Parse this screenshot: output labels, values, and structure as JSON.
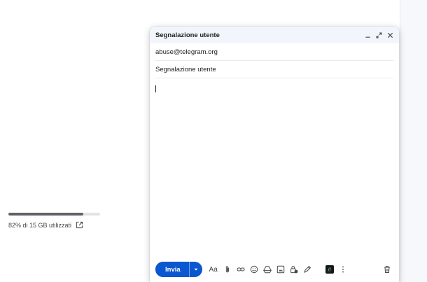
{
  "sidebar": {
    "storage": {
      "used_fraction": 0.82,
      "text": "82% di 15 GB utilizzati"
    }
  },
  "compose": {
    "title": "Segnalazione utente",
    "to": "abuse@telegram.org",
    "subject": "Segnalazione utente",
    "send_label": "Invia",
    "format_label": "Aa"
  },
  "colors": {
    "accent": "#0b57d0",
    "header_bg": "#f2f6fc"
  },
  "icons": [
    "minimize-icon",
    "expand-icon",
    "close-icon",
    "external-link-icon",
    "chevron-down-icon",
    "attach-icon",
    "link-icon",
    "emoji-icon",
    "drive-icon",
    "image-icon",
    "lock-clock-icon",
    "pen-icon",
    "extension-icon",
    "more-vert-icon",
    "trash-icon"
  ]
}
